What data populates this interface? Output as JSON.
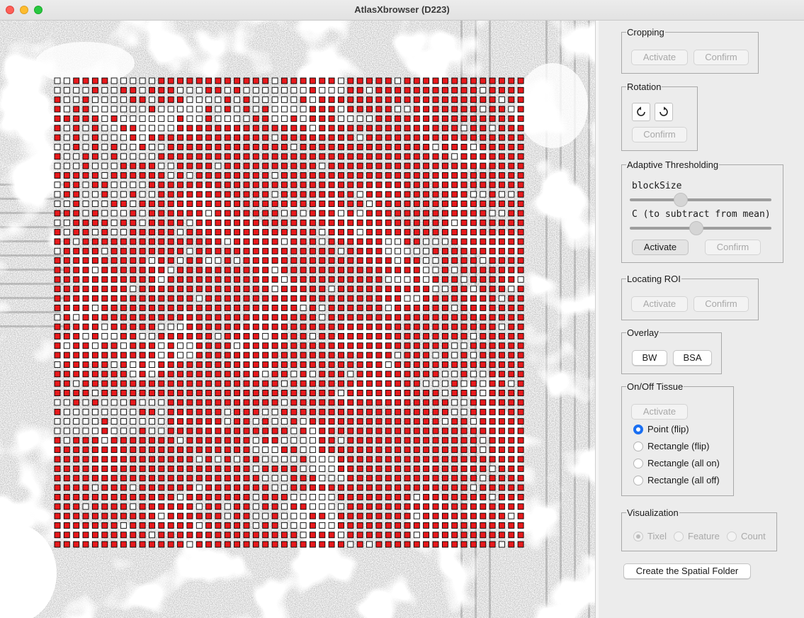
{
  "window": {
    "title": "AtlasXbrowser (D223)"
  },
  "canvas": {
    "grid_rows": 50,
    "grid_cols": 50,
    "on_color": "#e8191c",
    "off_color": "#ffffff"
  },
  "panel": {
    "cropping": {
      "legend": "Cropping",
      "activate": "Activate",
      "confirm": "Confirm"
    },
    "rotation": {
      "legend": "Rotation",
      "confirm": "Confirm"
    },
    "thresholding": {
      "legend": "Adaptive Thresholding",
      "blocksize_label": "blockSize",
      "c_label": "C (to subtract from mean)",
      "blocksize_level": 0.36,
      "c_level": 0.47,
      "activate": "Activate",
      "confirm": "Confirm"
    },
    "roi": {
      "legend": "Locating ROI",
      "activate": "Activate",
      "confirm": "Confirm"
    },
    "overlay": {
      "legend": "Overlay",
      "bw": "BW",
      "bsa": "BSA"
    },
    "tissue": {
      "legend": "On/Off Tissue",
      "activate": "Activate",
      "options": [
        "Point (flip)",
        "Rectangle (flip)",
        "Rectangle (all on)",
        "Rectangle (all off)"
      ],
      "selected": 0
    },
    "visualization": {
      "legend": "Visualization",
      "options": [
        "Tixel",
        "Feature",
        "Count"
      ],
      "selected": 0
    },
    "create_button": "Create the Spatial Folder"
  }
}
